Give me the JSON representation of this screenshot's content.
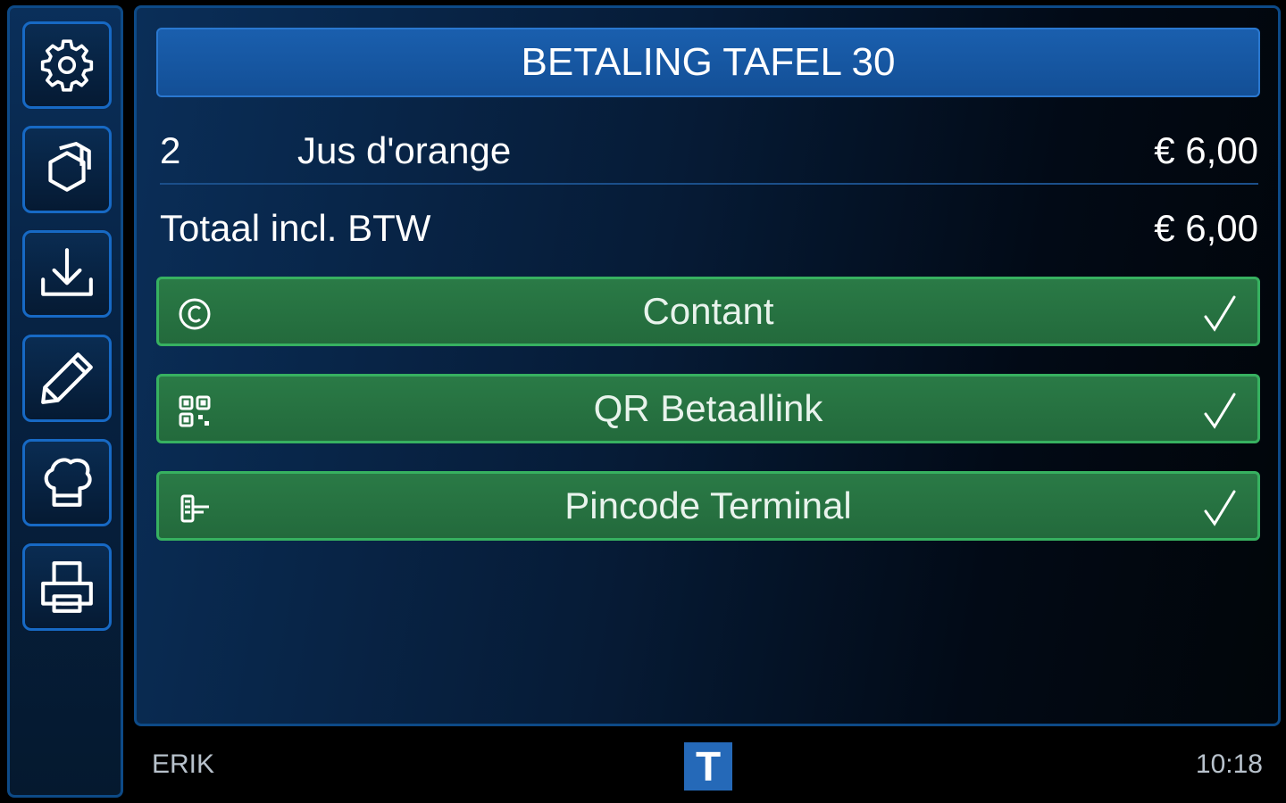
{
  "sidebar": {
    "items": [
      {
        "icon": "gear-icon"
      },
      {
        "icon": "cube-icon"
      },
      {
        "icon": "download-icon"
      },
      {
        "icon": "pencil-icon"
      },
      {
        "icon": "chef-hat-icon"
      },
      {
        "icon": "printer-icon"
      }
    ]
  },
  "header": {
    "title": "BETALING TAFEL 30"
  },
  "order": {
    "lines": [
      {
        "qty": "2",
        "name": "Jus d'orange",
        "price": "€ 6,00"
      }
    ],
    "total_label": "Totaal incl. BTW",
    "total_value": "€ 6,00"
  },
  "payment_methods": [
    {
      "label": "Contant",
      "icon": "cash-icon"
    },
    {
      "label": "QR Betaallink",
      "icon": "qr-code-icon"
    },
    {
      "label": "Pincode Terminal",
      "icon": "card-terminal-icon"
    }
  ],
  "footer": {
    "user": "ERIK",
    "logo_letter": "T",
    "time": "10:18"
  },
  "colors": {
    "accent_blue": "#1769c4",
    "title_bar": "#1a5fae",
    "pay_green": "#2a7a46",
    "pay_border": "#37b160"
  }
}
